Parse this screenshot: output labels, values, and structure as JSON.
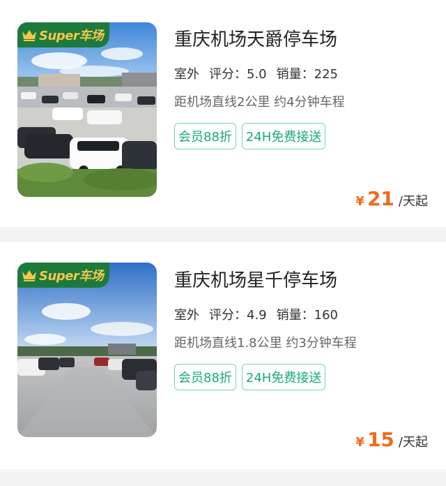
{
  "badge_label": "Super车场",
  "colors": {
    "accent_green": "#1da978",
    "price_orange": "#f26a1b",
    "badge_bg": "#1c7a3d",
    "badge_text": "#f6c64a"
  },
  "listings": [
    {
      "name": "重庆机场天爵停车场",
      "type": "室外",
      "rating_label": "评分：",
      "rating": "5.0",
      "sales_label": "销量：",
      "sales": "225",
      "distance": "距机场直线2公里 约4分钟车程",
      "tags": [
        "会员88折",
        "24H免费接送"
      ],
      "price_symbol": "¥",
      "price": "21",
      "price_unit": "/天起"
    },
    {
      "name": "重庆机场星千停车场",
      "type": "室外",
      "rating_label": "评分：",
      "rating": "4.9",
      "sales_label": "销量：",
      "sales": "160",
      "distance": "距机场直线1.8公里 约3分钟车程",
      "tags": [
        "会员88折",
        "24H免费接送"
      ],
      "price_symbol": "¥",
      "price": "15",
      "price_unit": "/天起"
    }
  ]
}
